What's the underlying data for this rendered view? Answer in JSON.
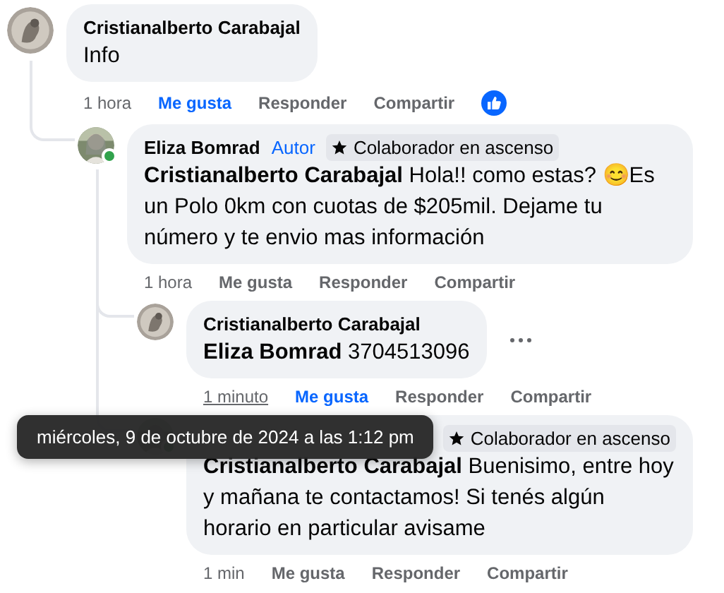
{
  "comments": [
    {
      "author": "Cristianalberto Carabajal",
      "text": "Info",
      "time": "1 hora",
      "time_hovered": false,
      "actions": [
        "Me gusta",
        "Responder",
        "Compartir"
      ],
      "liked": true,
      "has_reactions": true,
      "children": [
        {
          "author": "Eliza Bomrad",
          "author_label": "Autor",
          "badge": "Colaborador en ascenso",
          "online": true,
          "text": "**Cristianalberto Carabajal** Hola!! como estas? 😊Es un Polo 0km con cuotas de $205mil. Dejame tu número y te envio mas información",
          "time": "1 hora",
          "time_hovered": false,
          "actions": [
            "Me gusta",
            "Responder",
            "Compartir"
          ],
          "liked": false,
          "children": [
            {
              "author": "Cristianalberto Carabajal",
              "text": "**Eliza Bomrad** 3704513096",
              "time": "1 minuto",
              "time_hovered": true,
              "actions": [
                "Me gusta",
                "Responder",
                "Compartir"
              ],
              "liked": true,
              "menu": true
            },
            {
              "badge": "Colaborador en ascenso",
              "online": true,
              "text": "**Cristianalberto Carabajal** Buenisimo, entre hoy y mañana te contactamos! Si tenés algún horario en particular avisame",
              "time": "1 min",
              "time_hovered": false,
              "actions": [
                "Me gusta",
                "Responder",
                "Compartir"
              ],
              "liked": false
            }
          ]
        }
      ]
    }
  ],
  "tooltip": {
    "text": "miércoles, 9 de octubre de 2024 a las 1:12 pm"
  }
}
